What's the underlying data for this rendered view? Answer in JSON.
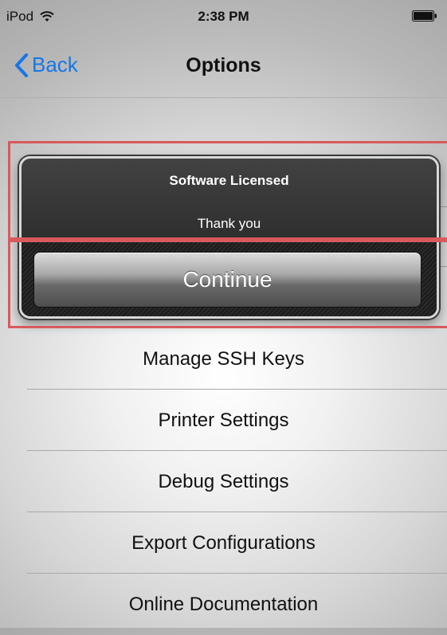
{
  "status_bar": {
    "device": "iPod",
    "time": "2:38 PM",
    "wifi_icon": "wifi-icon",
    "battery_icon": "battery-icon"
  },
  "nav": {
    "back_label": "Back",
    "back_icon": "chevron-left-icon",
    "title": "Options"
  },
  "alert": {
    "title": "Software Licensed",
    "message": "Thank you",
    "button_label": "Continue"
  },
  "options": {
    "items": [
      {
        "label": "Manage SSH Keys"
      },
      {
        "label": "Printer Settings"
      },
      {
        "label": "Debug Settings"
      },
      {
        "label": "Export Configurations"
      },
      {
        "label": "Online Documentation"
      }
    ]
  },
  "colors": {
    "accent": "#1577e8",
    "highlight": "#d9595d"
  }
}
